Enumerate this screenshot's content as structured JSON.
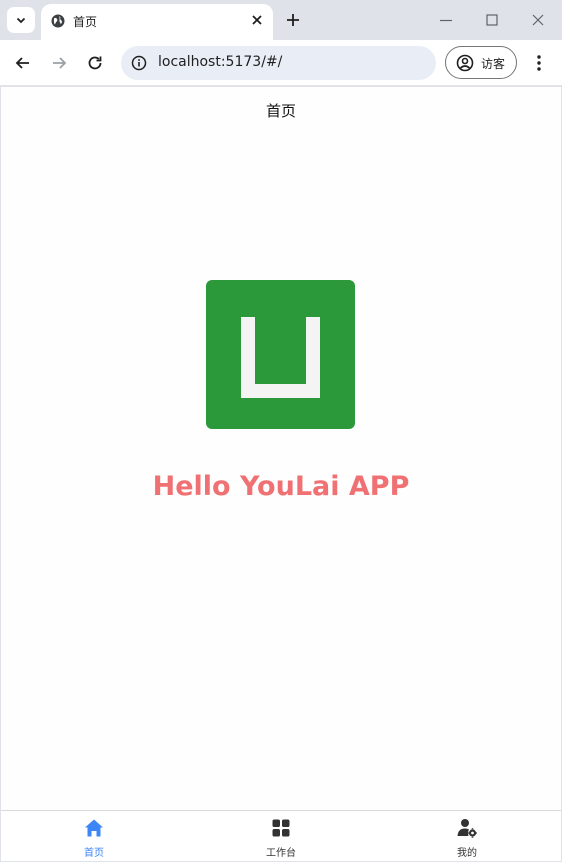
{
  "browser": {
    "tab_title": "首页",
    "url": "localhost:5173/#/",
    "profile_label": "访客"
  },
  "page": {
    "nav_title": "首页",
    "heading": "Hello YouLai APP",
    "heading_color": "#f07173",
    "logo_color": "#2b9939"
  },
  "tabbar": {
    "active_color": "#3c86f7",
    "items": [
      {
        "label": "首页",
        "icon": "home-icon",
        "active": true
      },
      {
        "label": "工作台",
        "icon": "grid-icon",
        "active": false
      },
      {
        "label": "我的",
        "icon": "user-settings-icon",
        "active": false
      }
    ]
  }
}
